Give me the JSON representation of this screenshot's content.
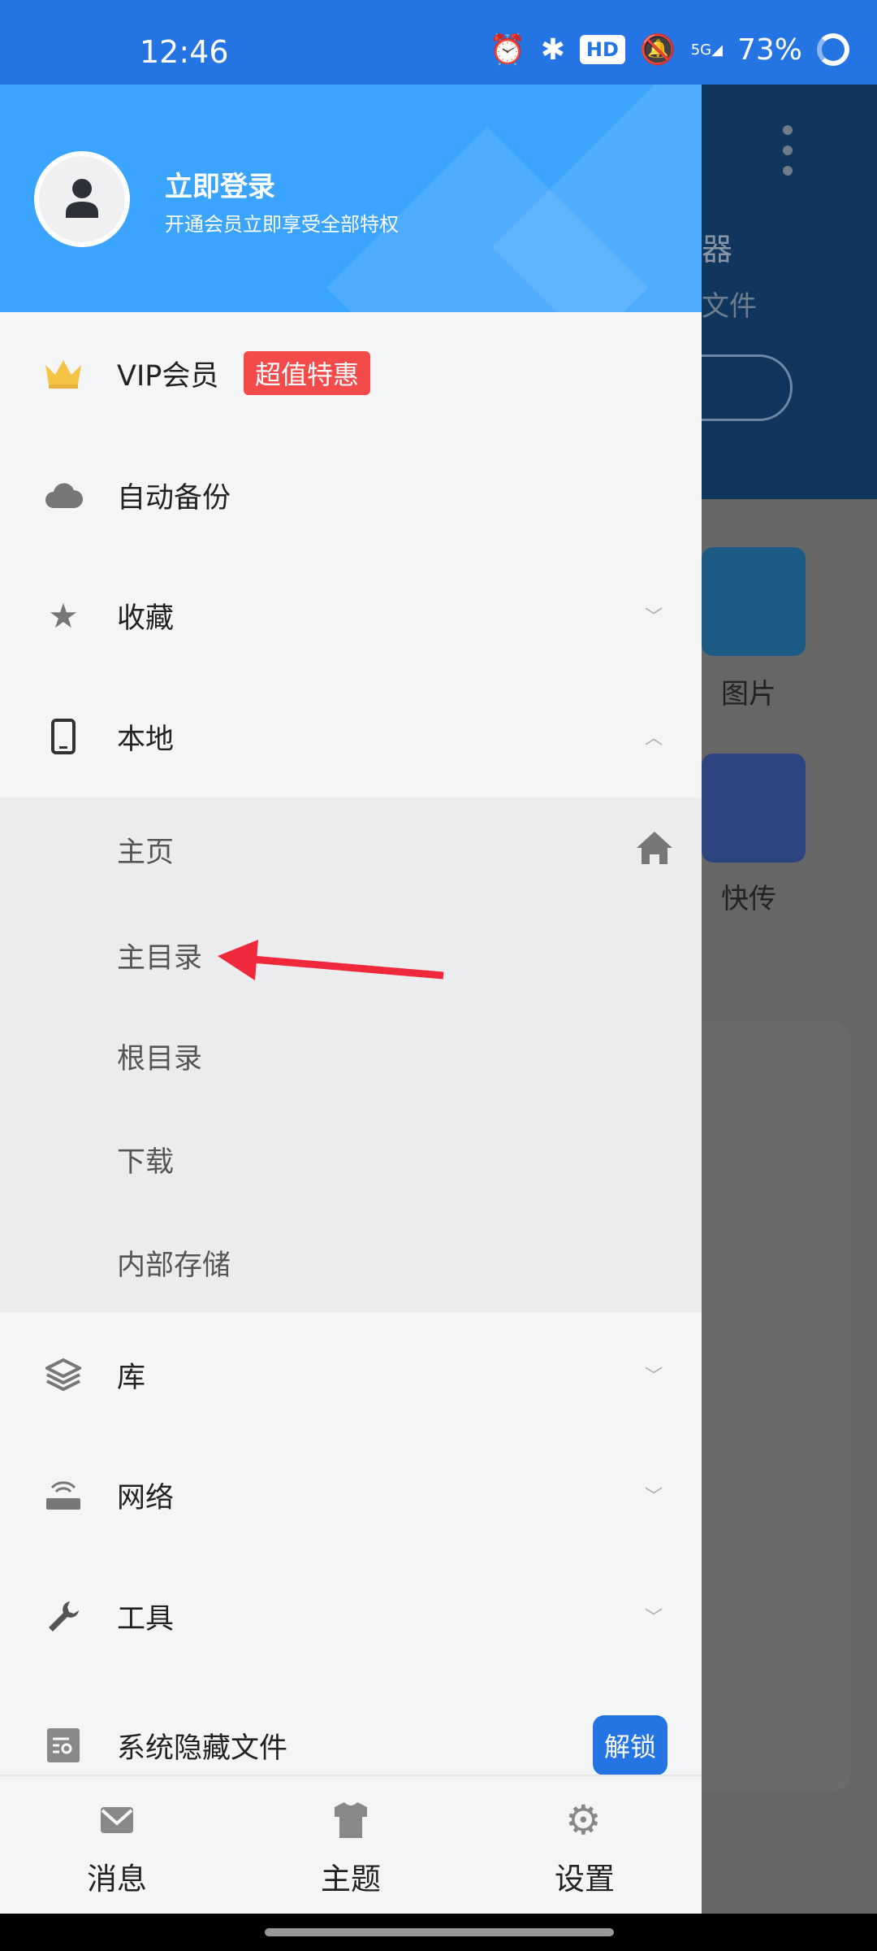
{
  "status_bar": {
    "time": "12:46",
    "battery": "73%",
    "network": "5G",
    "hd": "HD"
  },
  "background": {
    "title_fragment": "器",
    "subtitle_fragment": "文件",
    "tiles": [
      {
        "label": "图片"
      },
      {
        "label": "快传"
      }
    ]
  },
  "drawer": {
    "header": {
      "login": "立即登录",
      "subtitle": "开通会员立即享受全部特权"
    },
    "items": [
      {
        "label": "VIP会员",
        "badge": "超值特惠",
        "icon": "crown-icon"
      },
      {
        "label": "自动备份",
        "icon": "cloud-sync-icon"
      },
      {
        "label": "收藏",
        "icon": "star-icon",
        "expanded": false
      },
      {
        "label": "本地",
        "icon": "phone-icon",
        "expanded": true
      },
      {
        "label": "库",
        "icon": "layers-icon",
        "expanded": false
      },
      {
        "label": "网络",
        "icon": "router-icon",
        "expanded": false
      },
      {
        "label": "工具",
        "icon": "wrench-icon",
        "expanded": false
      },
      {
        "label": "系统隐藏文件",
        "icon": "hidden-file-icon",
        "button": "解锁"
      }
    ],
    "local_sub": [
      {
        "label": "主页"
      },
      {
        "label": "主目录"
      },
      {
        "label": "根目录"
      },
      {
        "label": "下载"
      },
      {
        "label": "内部存储"
      }
    ],
    "bottom_nav": [
      {
        "label": "消息",
        "icon": "mail-icon"
      },
      {
        "label": "主题",
        "icon": "shirt-icon"
      },
      {
        "label": "设置",
        "icon": "gear-icon"
      }
    ]
  },
  "colors": {
    "accent": "#2474e3",
    "header": "#3aa4fe",
    "badge": "#f44a4a",
    "annotation_arrow": "#f0283c"
  }
}
